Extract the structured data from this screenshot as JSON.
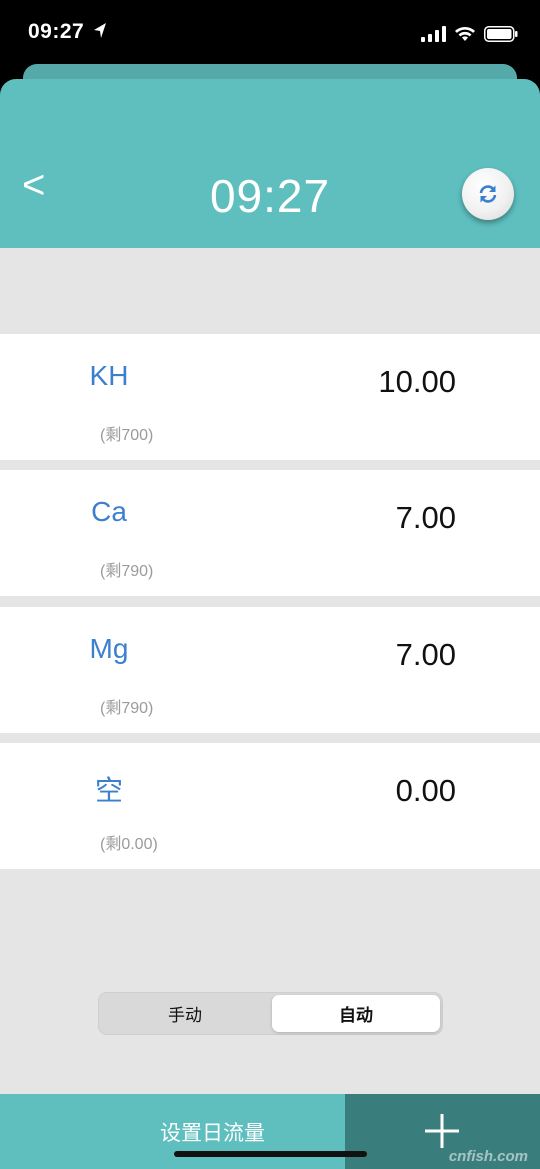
{
  "status_bar": {
    "time": "09:27"
  },
  "header": {
    "title": "09:27",
    "back_label": "<"
  },
  "items": [
    {
      "name": "KH",
      "remaining": "(剩700)",
      "value": "10.00"
    },
    {
      "name": "Ca",
      "remaining": "(剩790)",
      "value": "7.00"
    },
    {
      "name": "Mg",
      "remaining": "(剩790)",
      "value": "7.00"
    },
    {
      "name": "空",
      "remaining": "(剩0.00)",
      "value": "0.00"
    }
  ],
  "mode": {
    "manual_label": "手动",
    "auto_label": "自动",
    "selected": "自动"
  },
  "bottom": {
    "set_daily_flow_label": "设置日流量"
  },
  "watermark": "cnfish.com",
  "colors": {
    "teal": "#5fbfbf",
    "dark_teal": "#3a7d7d",
    "accent_blue": "#3b7fcf",
    "background": "#e5e5e5"
  }
}
